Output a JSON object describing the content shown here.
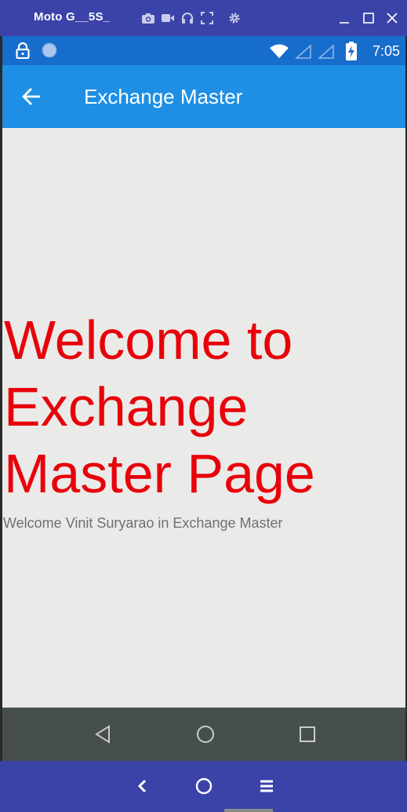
{
  "emulator": {
    "window_title": "Moto G__5S_",
    "tools": [
      "camera-icon",
      "video-icon",
      "headphones-icon",
      "fullscreen-icon",
      "settings-icon"
    ],
    "controls": [
      "minimize-icon",
      "maximize-icon",
      "close-icon"
    ],
    "bottom_nav": [
      "back-chevron-icon",
      "home-circle-icon",
      "menu-icon"
    ]
  },
  "status_bar": {
    "time": "7:05",
    "icons": [
      "lock-icon",
      "sync-icon",
      "wifi-icon",
      "signal-icon",
      "signal-icon",
      "battery-charging-icon"
    ]
  },
  "app_bar": {
    "title": "Exchange Master",
    "back_icon": "arrow-back-icon"
  },
  "content": {
    "heading": "Welcome to Exchange Master Page",
    "subtitle": "Welcome Vinit Suryarao in Exchange Master"
  },
  "nav_bar": {
    "buttons": [
      "back-triangle-icon",
      "home-circle-icon",
      "recents-square-icon"
    ]
  },
  "colors": {
    "status_bar": "#176dcb",
    "app_bar": "#1e8fe4",
    "heading_red": "#e8000b",
    "background": "#eaebe8",
    "nav_bar": "#474f4e",
    "emulator_chrome": "#3b43a9"
  }
}
